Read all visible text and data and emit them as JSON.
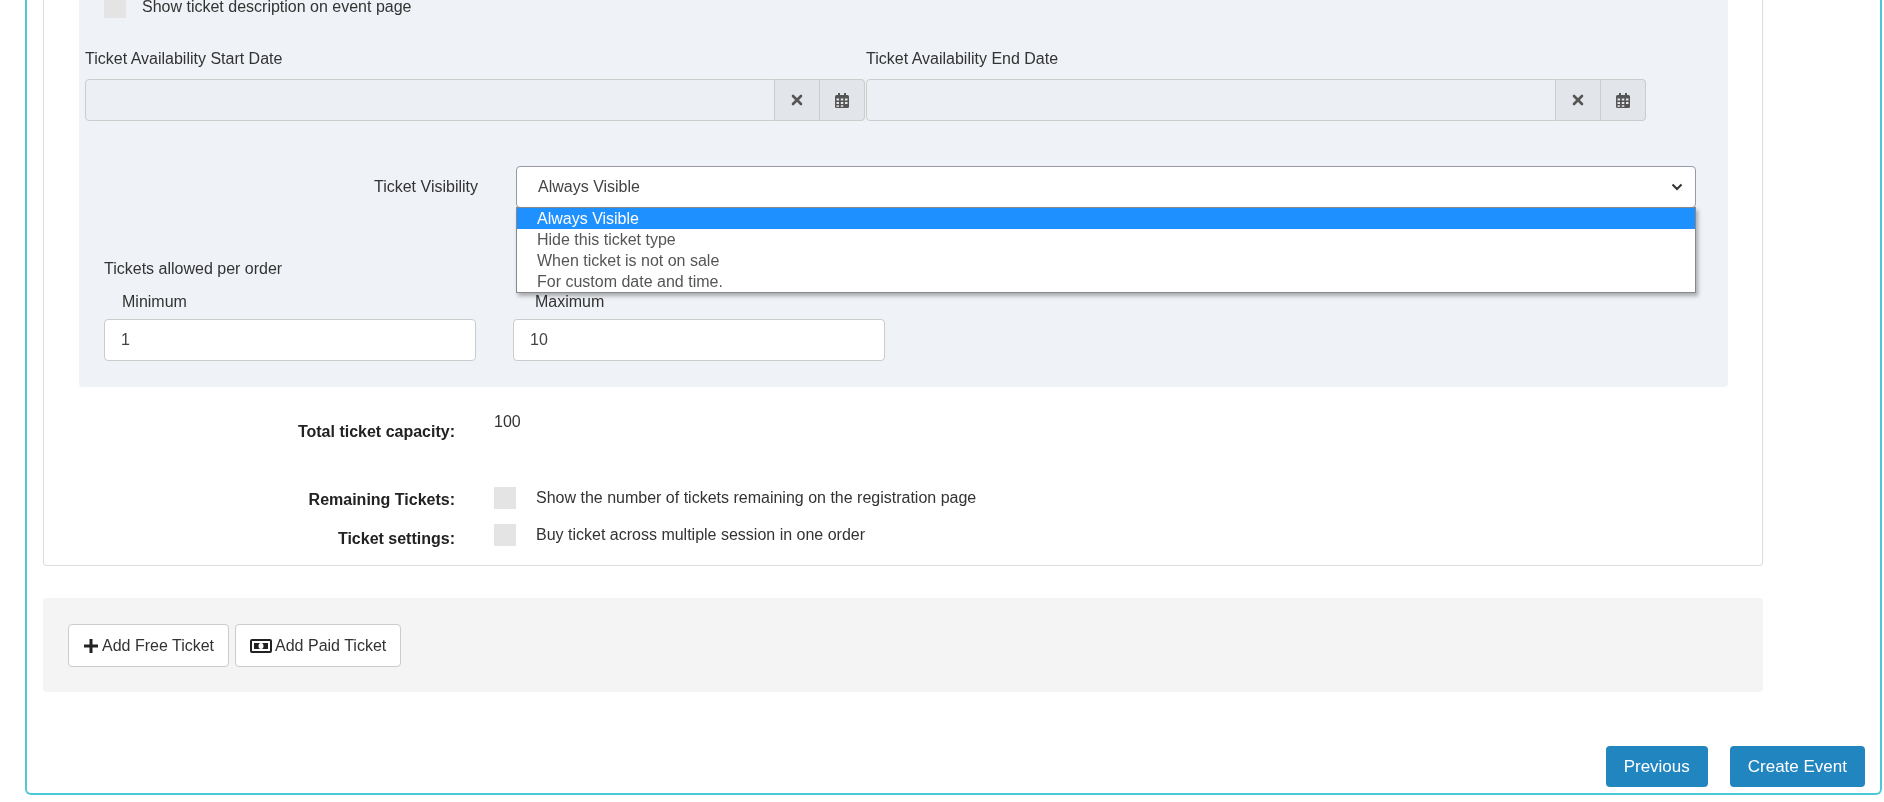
{
  "description_option": {
    "label": "Show ticket description on event page",
    "checked": false
  },
  "date_fields": [
    {
      "label": "Ticket Availability Start Date"
    },
    {
      "label": "Ticket Availability End Date"
    }
  ],
  "visibility": {
    "label": "Ticket Visibility",
    "value": "Always Visible",
    "expanded": true,
    "options": [
      {
        "label": "Always Visible",
        "selected": true
      },
      {
        "label": "Hide this ticket type",
        "selected": false
      },
      {
        "label": "When ticket is not on sale",
        "selected": false
      },
      {
        "label": "For custom date and time.",
        "selected": false
      }
    ]
  },
  "per_order": {
    "label": "Tickets allowed per order",
    "fields": [
      {
        "label": "Minimum",
        "value": "1"
      },
      {
        "label": "Maximum",
        "value": "10"
      }
    ]
  },
  "capacity": {
    "label": "Total ticket capacity:",
    "value": "100"
  },
  "settings": [
    {
      "label": "Remaining Tickets:",
      "option": "Show the number of tickets remaining on the registration page",
      "checked": false
    },
    {
      "label": "Ticket settings:",
      "option": "Buy ticket across multiple session in one order",
      "checked": false
    }
  ],
  "add_buttons": [
    {
      "label": "Add Free Ticket",
      "kind": "free"
    },
    {
      "label": "Add Paid Ticket",
      "kind": "paid"
    }
  ],
  "nav_buttons": [
    "Previous",
    "Create Event"
  ]
}
